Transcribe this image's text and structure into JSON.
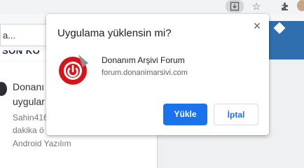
{
  "page": {
    "search_partial": "a...",
    "section_title": "SON KO",
    "post": {
      "title_line1": "Donanı",
      "title_line2": "uygular",
      "meta_line1": "Sahin416",
      "meta_line2": "dakika ö",
      "category": "Android Yazılım"
    }
  },
  "toolbar": {
    "install_icon": "install-app-icon",
    "star_icon": "star-icon",
    "extensions_icon": "puzzle-icon"
  },
  "dialog": {
    "title": "Uygulama yüklensin mi?",
    "close_label": "×",
    "app_name": "Donanım Arşivi Forum",
    "app_url": "forum.donanimarsivi.com",
    "install_label": "Yükle",
    "cancel_label": "İptal"
  },
  "colors": {
    "accent": "#1a73e8",
    "app_icon_red": "#d6141c",
    "site_blue": "#2f6fb0"
  }
}
